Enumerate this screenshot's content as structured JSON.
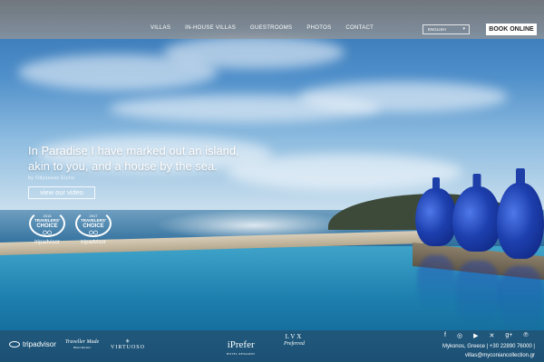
{
  "nav": {
    "items": [
      "VILLAS",
      "IN-HOUSE VILLAS",
      "GUESTROOMS",
      "PHOTOS",
      "CONTACT"
    ],
    "language": "ENGLISH",
    "book_label": "BOOK ONLINE"
  },
  "hero": {
    "line1": "In Paradise I have marked out an island,",
    "line2": "akin to you, and a house by the sea.",
    "byline": "by Odysseas Elytis",
    "video_label": "view our video"
  },
  "awards": [
    {
      "year": "2016",
      "line1": "TRAVELERS'",
      "line2": "CHOICE",
      "brand": "tripadvisor"
    },
    {
      "year": "2017",
      "line1": "TRAVELERS'",
      "line2": "CHOICE",
      "brand": "tripadvisor"
    }
  ],
  "footer": {
    "logos": {
      "tripadvisor": "tripadvisor",
      "travel_made_main": "Traveller Made",
      "travel_made_sub": "Hotel Partner",
      "virtuoso": "VIRTUOSO",
      "iprefer_main": "iPrefer",
      "iprefer_sub": "HOTEL REWARDS",
      "lvx_main": "LVX",
      "lvx_sub": "Preferred"
    },
    "socials": [
      "facebook-icon",
      "instagram-icon",
      "youtube-icon",
      "twitter-icon",
      "google-plus-icon",
      "pinterest-icon"
    ],
    "contact": "Mykonos, Greece  |  +30 22890 76000  |",
    "email": "villas@myconiancollection.gr"
  },
  "colors": {
    "jar": "#1d3fae",
    "pool": "#1d7fae",
    "topbar": "#8c8c8c"
  }
}
